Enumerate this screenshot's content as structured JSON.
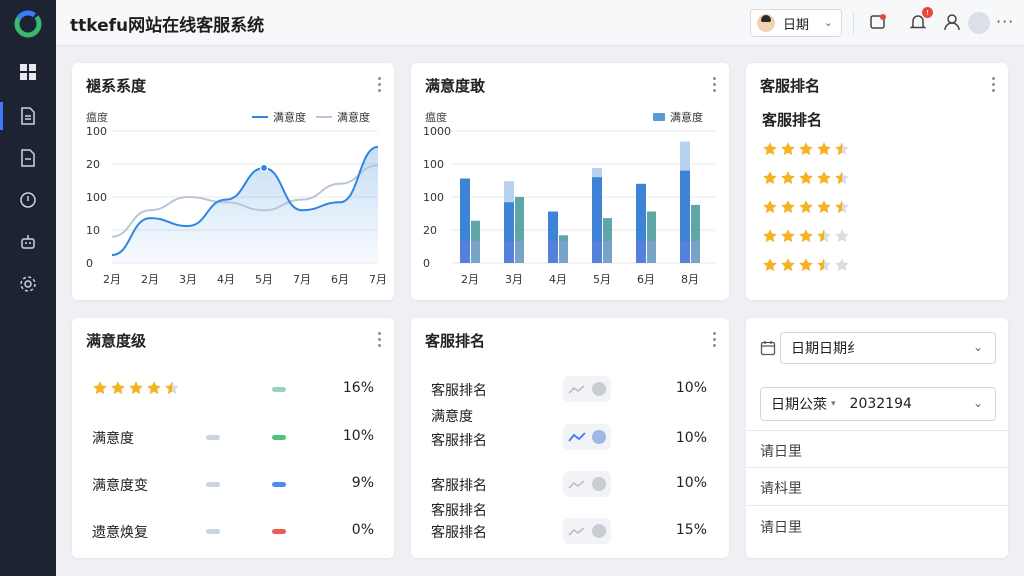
{
  "app": {
    "title": "ttkefu网站在线客服系统"
  },
  "header": {
    "date_select_label": "日期",
    "notification_badge": "!"
  },
  "colors": {
    "accent": "#3d7bfd",
    "sidebar_bg": "#1d2333",
    "star": "#f5b324",
    "line_primary": "#2e86de",
    "line_secondary": "#b9c6d9"
  },
  "sidebar": {
    "items": [
      {
        "icon": "dashboard-icon",
        "active": false
      },
      {
        "icon": "document-icon",
        "active": true
      },
      {
        "icon": "file-icon",
        "active": false
      },
      {
        "icon": "chat-icon",
        "active": false
      },
      {
        "icon": "robot-icon",
        "active": false
      },
      {
        "icon": "gear-icon",
        "active": false
      }
    ]
  },
  "card1": {
    "title": "褪系系度",
    "unit_label": "瘟度",
    "legend": [
      "满意度",
      "满意度"
    ],
    "chart_data": {
      "type": "line",
      "categories": [
        "2月",
        "2月",
        "3月",
        "4月",
        "5月",
        "7月",
        "6月",
        "7月"
      ],
      "y_tick_labels": [
        "100",
        "20",
        "100",
        "10",
        "0"
      ],
      "series": [
        {
          "name": "满意度",
          "values": [
            0.06,
            0.34,
            0.28,
            0.48,
            0.72,
            0.4,
            0.46,
            0.88
          ]
        },
        {
          "name": "满意度",
          "values": [
            0.2,
            0.4,
            0.5,
            0.46,
            0.4,
            0.48,
            0.6,
            0.74
          ]
        }
      ],
      "ylim": [
        0,
        1
      ],
      "value_scale": "normalized",
      "grid": true,
      "legend_position": "top-right"
    }
  },
  "card2": {
    "title": "满意度敢",
    "unit_label": "瘟度",
    "legend": [
      "满意度"
    ],
    "chart_data": {
      "type": "bar",
      "categories": [
        "2月",
        "3月",
        "4月",
        "5月",
        "6月",
        "8月"
      ],
      "y_tick_labels": [
        "1000",
        "100",
        "100",
        "20",
        "0"
      ],
      "series": [
        {
          "name": "series-a",
          "values": [
            0.64,
            0.46,
            0.39,
            0.65,
            0.6,
            0.7
          ]
        },
        {
          "name": "series-a-light",
          "values": [
            0.0,
            0.62,
            0.0,
            0.72,
            0.0,
            0.92
          ]
        },
        {
          "name": "series-b",
          "values": [
            0.32,
            0.5,
            0.21,
            0.34,
            0.39,
            0.44
          ]
        }
      ],
      "ylim": [
        0,
        1
      ],
      "value_scale": "normalized",
      "grid": true,
      "legend_position": "top-right"
    }
  },
  "card3": {
    "title": "客服排名",
    "subtitle": "客服排名",
    "ratings": [
      4.5,
      4.5,
      4.5,
      3.5,
      3.5
    ]
  },
  "card4": {
    "title": "满意度级",
    "rows": [
      {
        "label": "",
        "stars": 4.5,
        "mini1": "#c9d3e3",
        "mini2": "#9fcfc2",
        "value": "16%"
      },
      {
        "label": "满意度",
        "stars": null,
        "mini1": "#c9d3e3",
        "mini2": "#52c27a",
        "value": "10%"
      },
      {
        "label": "满意度变",
        "stars": null,
        "mini1": "#c9d3e3",
        "mini2": "#4d8bf0",
        "value": "9%"
      },
      {
        "label": "遗意焕复",
        "stars": null,
        "mini1": "#c9d3e3",
        "mini2": "#ee5a5a",
        "value": "0%"
      }
    ]
  },
  "card5": {
    "title": "客服排名",
    "rows": [
      {
        "label": "客服排名",
        "label2": "满意度",
        "value": "10%",
        "active": false
      },
      {
        "label": "客服排名",
        "label2": "",
        "value": "10%",
        "active": true
      },
      {
        "label": "客服排名",
        "label2": "客服排名",
        "value": "10%",
        "active": false
      },
      {
        "label": "客服排名",
        "label2": "",
        "value": "15%",
        "active": false
      }
    ]
  },
  "card6": {
    "select1": "日期日期纟",
    "select2_prefix": "日期公萊",
    "select2_value": "2032194",
    "rows": [
      "请日里",
      "请枓里",
      "请日里"
    ]
  }
}
